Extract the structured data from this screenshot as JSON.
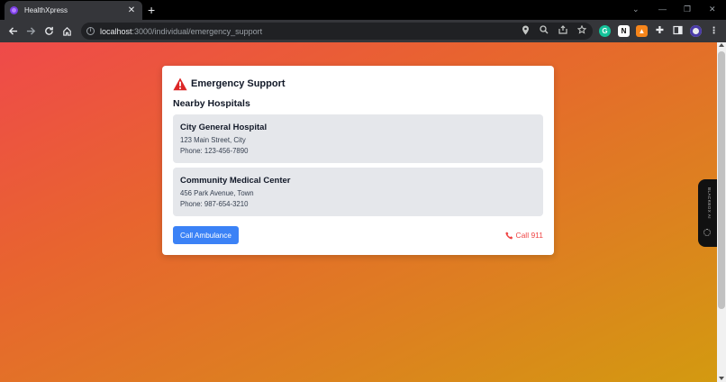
{
  "browser": {
    "tab_title": "HealthXpress",
    "tab_close": "✕",
    "new_tab": "+",
    "url_host": "localhost",
    "url_rest": ":3000/individual/emergency_support"
  },
  "card": {
    "title": "Emergency Support",
    "section_title": "Nearby Hospitals",
    "hospitals": [
      {
        "name": "City General Hospital",
        "address": "123 Main Street, City",
        "phone": "Phone: 123-456-7890"
      },
      {
        "name": "Community Medical Center",
        "address": "456 Park Avenue, Town",
        "phone": "Phone: 987-654-3210"
      }
    ],
    "ambulance_button": "Call Ambulance",
    "call_link": "Call 911"
  },
  "side_widget": {
    "label": "BLACKBOX AI"
  },
  "colors": {
    "primary_button": "#3b82f6",
    "danger": "#ef4444",
    "card_item_bg": "#e5e7eb"
  }
}
